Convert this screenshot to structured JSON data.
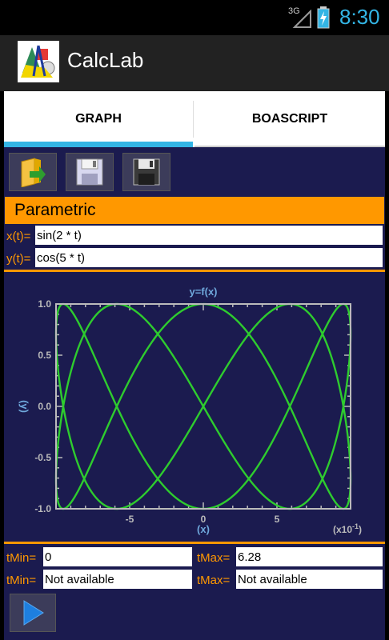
{
  "status_bar": {
    "network": "3G",
    "time": "8:30"
  },
  "app": {
    "title": "CalcLab"
  },
  "tabs": [
    {
      "label": "GRAPH"
    },
    {
      "label": "BOASCRIPT"
    }
  ],
  "toolbar": {
    "open_icon": "folder-open-icon",
    "save_icon": "save-disk-icon",
    "save_as_icon": "save-disk-dark-icon"
  },
  "section": {
    "title": "Parametric"
  },
  "fields": {
    "x_label": "x(t)=",
    "x_value": "sin(2 * t)",
    "y_label": "y(t)=",
    "y_value": "cos(5 * t)"
  },
  "chart_data": {
    "type": "line",
    "title": "y=f(x)",
    "xlabel": "(x)",
    "ylabel": "(y)",
    "x_multiplier": "(x10",
    "x_multiplier_exp": "-1",
    "x_multiplier_close": ")",
    "xlim": [
      -10,
      10
    ],
    "ylim": [
      -1.0,
      1.0
    ],
    "x_ticks": [
      "-5",
      "0",
      "5"
    ],
    "y_ticks": [
      "1.0",
      "0.5",
      "0.0",
      "-0.5",
      "-1.0"
    ],
    "series": [
      {
        "x_expr": "sin(2 * t)",
        "y_expr": "cos(5 * t)",
        "t_range": [
          0,
          6.28
        ]
      }
    ],
    "colors": {
      "curve": "#2ecc2e",
      "frame": "#bbbbbb",
      "background": "#1b1b4f",
      "title": "#6fa8dc"
    },
    "grid": false
  },
  "range": {
    "tmin_label": "tMin=",
    "tmin_value": "0",
    "tmax_label": "tMax=",
    "tmax_value": "6.28",
    "tmin2_label": "tMin=",
    "tmin2_value": "Not available",
    "tmax2_label": "tMax=",
    "tmax2_value": "Not available"
  },
  "run": {
    "icon": "play-icon"
  },
  "colors": {
    "accent_blue": "#33b5e5",
    "accent_orange": "#ff9800",
    "panel": "#1b1b4f"
  }
}
